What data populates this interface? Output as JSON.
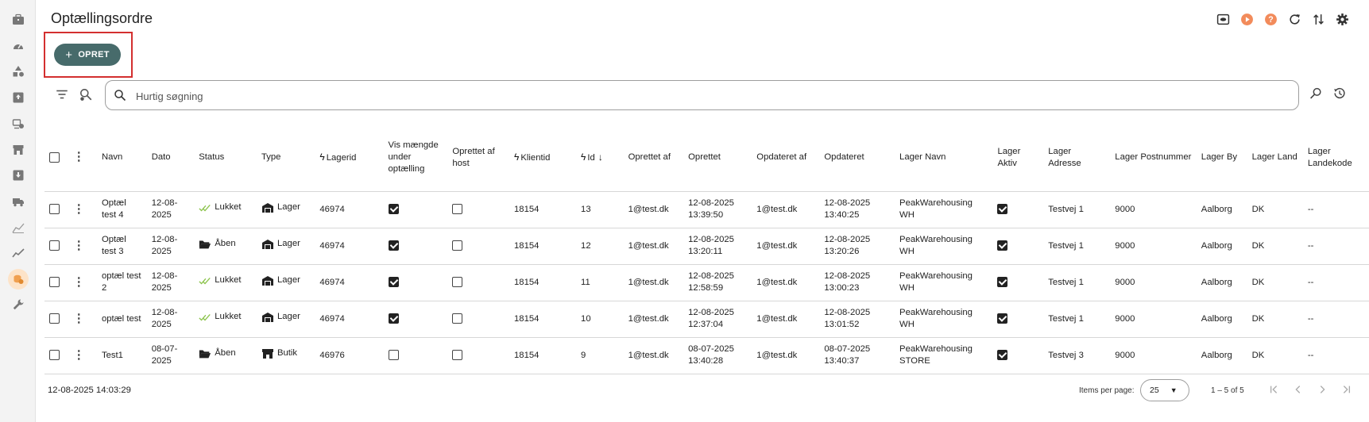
{
  "page": {
    "title": "Optællingsordre"
  },
  "toolbar": {
    "create_label": "OPRET"
  },
  "search": {
    "placeholder": "Hurtig søgning"
  },
  "table": {
    "headers": {
      "navn": "Navn",
      "dato": "Dato",
      "status": "Status",
      "type": "Type",
      "lagerid": "Lagerid",
      "vis_maengde": "Vis mængde under optælling",
      "oprettet_host": "Oprettet af host",
      "klientid": "Klientid",
      "id": "Id",
      "oprettet_af": "Oprettet af",
      "oprettet": "Oprettet",
      "opdateret_af": "Opdateret af",
      "opdateret": "Opdateret",
      "lager_navn": "Lager Navn",
      "lager_aktiv": "Lager Aktiv",
      "lager_adresse": "Lager Adresse",
      "lager_postnummer": "Lager Postnummer",
      "lager_by": "Lager By",
      "lager_land": "Lager Land",
      "lager_landekode": "Lager Landekode"
    },
    "rows": [
      {
        "navn": "Optæl test 4",
        "dato": "12-08-2025",
        "status": "Lukket",
        "status_icon": "check-double-icon",
        "type": "Lager",
        "type_icon": "warehouse-icon",
        "lagerid": "46974",
        "vis_maengde": true,
        "oprettet_host": false,
        "klientid": "18154",
        "id": "13",
        "oprettet_af": "1@test.dk",
        "oprettet": "12-08-2025 13:39:50",
        "opdateret_af": "1@test.dk",
        "opdateret": "12-08-2025 13:40:25",
        "lager_navn": "PeakWarehousing WH",
        "lager_aktiv": true,
        "lager_adresse": "Testvej 1",
        "lager_postnummer": "9000",
        "lager_by": "Aalborg",
        "lager_land": "DK",
        "lager_landekode": "--"
      },
      {
        "navn": "Optæl test 3",
        "dato": "12-08-2025",
        "status": "Åben",
        "status_icon": "folder-open-icon",
        "type": "Lager",
        "type_icon": "warehouse-icon",
        "lagerid": "46974",
        "vis_maengde": true,
        "oprettet_host": false,
        "klientid": "18154",
        "id": "12",
        "oprettet_af": "1@test.dk",
        "oprettet": "12-08-2025 13:20:11",
        "opdateret_af": "1@test.dk",
        "opdateret": "12-08-2025 13:20:26",
        "lager_navn": "PeakWarehousing WH",
        "lager_aktiv": true,
        "lager_adresse": "Testvej 1",
        "lager_postnummer": "9000",
        "lager_by": "Aalborg",
        "lager_land": "DK",
        "lager_landekode": "--"
      },
      {
        "navn": "optæl test 2",
        "dato": "12-08-2025",
        "status": "Lukket",
        "status_icon": "check-double-icon",
        "type": "Lager",
        "type_icon": "warehouse-icon",
        "lagerid": "46974",
        "vis_maengde": true,
        "oprettet_host": false,
        "klientid": "18154",
        "id": "11",
        "oprettet_af": "1@test.dk",
        "oprettet": "12-08-2025 12:58:59",
        "opdateret_af": "1@test.dk",
        "opdateret": "12-08-2025 13:00:23",
        "lager_navn": "PeakWarehousing WH",
        "lager_aktiv": true,
        "lager_adresse": "Testvej 1",
        "lager_postnummer": "9000",
        "lager_by": "Aalborg",
        "lager_land": "DK",
        "lager_landekode": "--"
      },
      {
        "navn": "optæl test",
        "dato": "12-08-2025",
        "status": "Lukket",
        "status_icon": "check-double-icon",
        "type": "Lager",
        "type_icon": "warehouse-icon",
        "lagerid": "46974",
        "vis_maengde": true,
        "oprettet_host": false,
        "klientid": "18154",
        "id": "10",
        "oprettet_af": "1@test.dk",
        "oprettet": "12-08-2025 12:37:04",
        "opdateret_af": "1@test.dk",
        "opdateret": "12-08-2025 13:01:52",
        "lager_navn": "PeakWarehousing WH",
        "lager_aktiv": true,
        "lager_adresse": "Testvej 1",
        "lager_postnummer": "9000",
        "lager_by": "Aalborg",
        "lager_land": "DK",
        "lager_landekode": "--"
      },
      {
        "navn": "Test1",
        "dato": "08-07-2025",
        "status": "Åben",
        "status_icon": "folder-open-icon",
        "type": "Butik",
        "type_icon": "store-icon",
        "lagerid": "46976",
        "vis_maengde": false,
        "oprettet_host": false,
        "klientid": "18154",
        "id": "9",
        "oprettet_af": "1@test.dk",
        "oprettet": "08-07-2025 13:40:28",
        "opdateret_af": "1@test.dk",
        "opdateret": "08-07-2025 13:40:37",
        "lager_navn": "PeakWarehousing STORE",
        "lager_aktiv": true,
        "lager_adresse": "Testvej 3",
        "lager_postnummer": "9000",
        "lager_by": "Aalborg",
        "lager_land": "DK",
        "lager_landekode": "--"
      }
    ]
  },
  "footer": {
    "timestamp": "12-08-2025 14:03:29",
    "items_per_page_label": "Items per page:",
    "items_per_page_value": "25",
    "range_label": "1 – 5 of 5"
  },
  "colors": {
    "accent": "#476b6b",
    "highlight_border": "#d32f2f",
    "top_orange": "#f28b5b",
    "status_green": "#8bc34a"
  }
}
